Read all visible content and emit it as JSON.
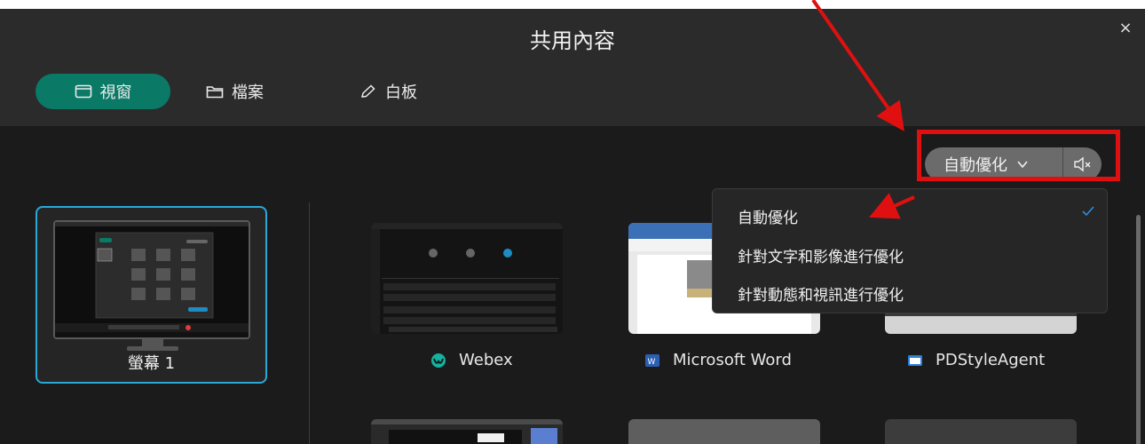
{
  "banner": {
    "text": ""
  },
  "dialog": {
    "title": "共用內容",
    "close": "×"
  },
  "tabs": [
    {
      "label": "視窗",
      "icon": "window-icon",
      "selected": true
    },
    {
      "label": "檔案",
      "icon": "folder-icon",
      "selected": false
    },
    {
      "label": "白板",
      "icon": "pen-icon",
      "selected": false
    }
  ],
  "optimize": {
    "selected": "自動優化",
    "icon": "chevron-down-icon",
    "mute_icon": "speaker-muted-icon",
    "options": [
      {
        "label": "自動優化",
        "checked": true
      },
      {
        "label": "針對文字和影像進行優化",
        "checked": false
      },
      {
        "label": "針對動態和視訊進行優化",
        "checked": false
      }
    ]
  },
  "sources": [
    {
      "label": "螢幕 1",
      "type": "screen",
      "selected": true
    },
    {
      "label": "Webex",
      "icon": "webex-icon"
    },
    {
      "label": "Microsoft Word",
      "icon": "word-icon"
    },
    {
      "label": "PDStyleAgent",
      "icon": "app-window-icon"
    }
  ],
  "colors": {
    "accent": "#0a7a67",
    "selection_border": "#2aa8d8",
    "annotation_red": "#e01010"
  }
}
